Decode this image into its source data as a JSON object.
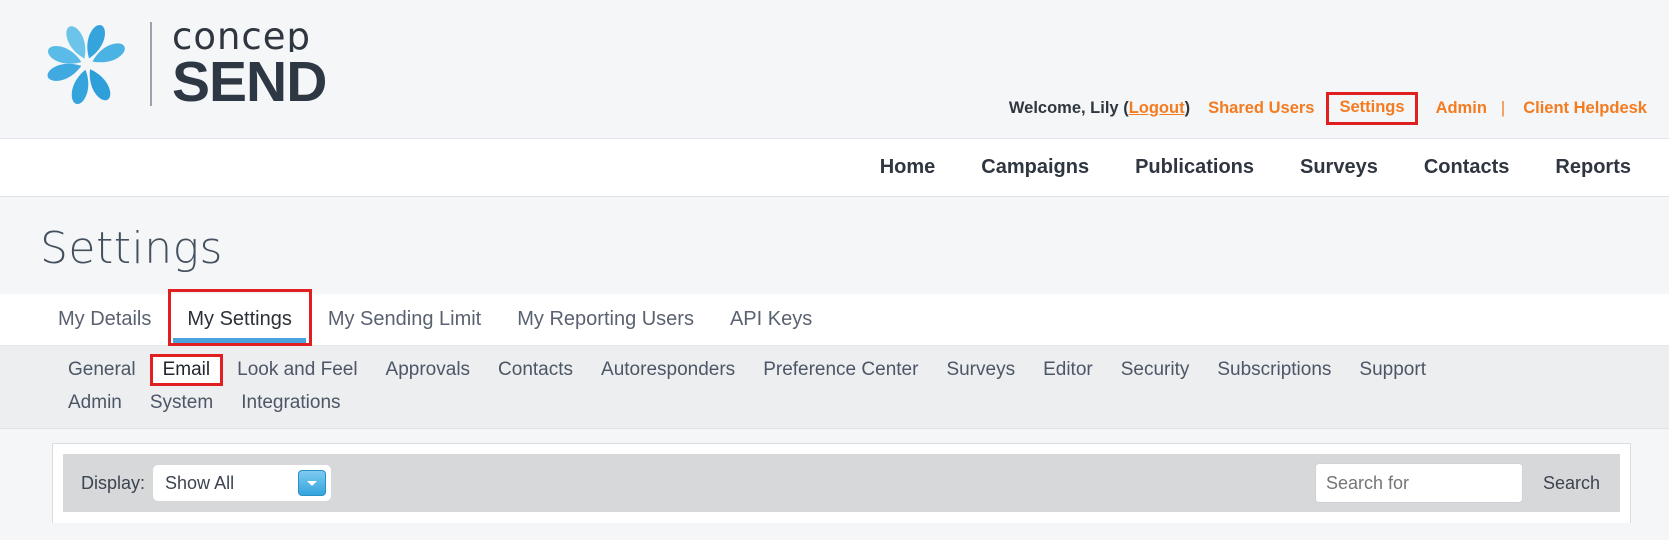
{
  "brand": {
    "logo_icon": "concep-flower-icon",
    "name_top": "concep",
    "name_bottom": "SEND",
    "accent_blue": "#35a4dd",
    "accent_orange": "#f47b20",
    "highlight_red": "#e02020"
  },
  "userbar": {
    "welcome_prefix": "Welcome, Lily (",
    "logout_label": "Logout",
    "welcome_suffix": ")",
    "shared_users_label": "Shared Users",
    "settings_label": "Settings",
    "admin_label": "Admin",
    "separator": "|",
    "helpdesk_label": "Client Helpdesk"
  },
  "mainnav": {
    "items": [
      {
        "label": "Home"
      },
      {
        "label": "Campaigns"
      },
      {
        "label": "Publications"
      },
      {
        "label": "Surveys"
      },
      {
        "label": "Contacts"
      },
      {
        "label": "Reports"
      }
    ]
  },
  "page": {
    "title": "Settings"
  },
  "primary_tabs": {
    "items": [
      {
        "label": "My Details",
        "active": false
      },
      {
        "label": "My Settings",
        "active": true
      },
      {
        "label": "My Sending Limit",
        "active": false
      },
      {
        "label": "My Reporting Users",
        "active": false
      },
      {
        "label": "API Keys",
        "active": false
      }
    ]
  },
  "secondary_tabs": {
    "row1": [
      {
        "label": "General",
        "highlighted": false
      },
      {
        "label": "Email",
        "highlighted": true
      },
      {
        "label": "Look and Feel",
        "highlighted": false
      },
      {
        "label": "Approvals",
        "highlighted": false
      },
      {
        "label": "Contacts",
        "highlighted": false
      },
      {
        "label": "Autoresponders",
        "highlighted": false
      },
      {
        "label": "Preference Center",
        "highlighted": false
      },
      {
        "label": "Surveys",
        "highlighted": false
      },
      {
        "label": "Editor",
        "highlighted": false
      },
      {
        "label": "Security",
        "highlighted": false
      },
      {
        "label": "Subscriptions",
        "highlighted": false
      },
      {
        "label": "Support",
        "highlighted": false
      }
    ],
    "row2": [
      {
        "label": "Admin",
        "highlighted": false
      },
      {
        "label": "System",
        "highlighted": false
      },
      {
        "label": "Integrations",
        "highlighted": false
      }
    ]
  },
  "toolbar": {
    "display_label": "Display:",
    "display_value": "Show All",
    "display_arrow_icon": "chevron-down-icon",
    "search_placeholder": "Search for",
    "search_value": "",
    "search_button_label": "Search"
  }
}
